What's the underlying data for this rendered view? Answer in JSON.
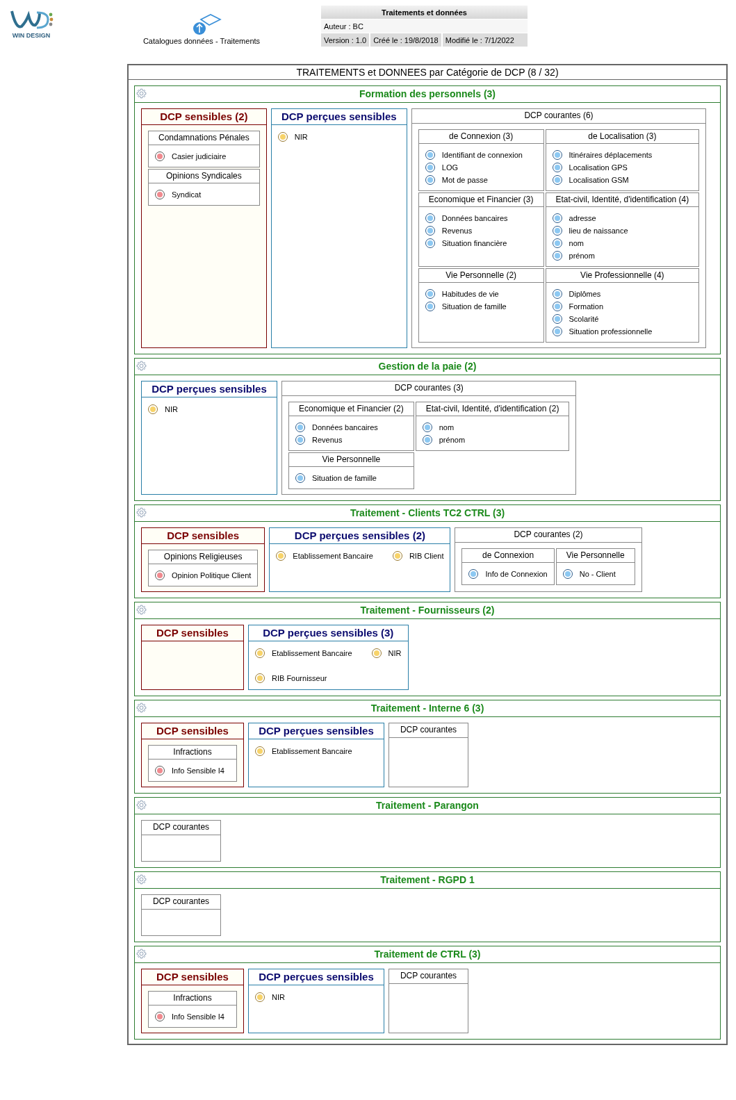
{
  "logo": {
    "wordmark": "WIN DESIGN"
  },
  "catalog": {
    "label": "Catalogues données - Traitements"
  },
  "info": {
    "title": "Traitements et données",
    "author": "Auteur : BC",
    "version": "Version : 1.0",
    "created": "Créé le : 19/8/2018",
    "modified": "Modifié le : 7/1/2022"
  },
  "diagram": {
    "title": "TRAITEMENTS et DONNEES par Catégorie de DCP (8 / 32)",
    "sections": [
      {
        "title": "Formation des personnels (3)",
        "panels": [
          {
            "kind": "sensitive",
            "title": "DCP sensibles (2)",
            "groups": [
              {
                "title": "Condamnations Pénales",
                "items": [
                  "Casier judiciaire"
                ]
              },
              {
                "title": "Opinions Syndicales",
                "items": [
                  "Syndicat"
                ]
              }
            ]
          },
          {
            "kind": "perceived",
            "title": "DCP perçues sensibles",
            "items": [
              "NIR"
            ]
          },
          {
            "kind": "common",
            "title": "DCP courantes (6)",
            "groups": [
              {
                "title": "de Connexion (3)",
                "items": [
                  "Identifiant de connexion",
                  "LOG",
                  "Mot de passe"
                ]
              },
              {
                "title": "de Localisation (3)",
                "items": [
                  "Itinéraires déplacements",
                  "Localisation GPS",
                  "Localisation GSM"
                ]
              },
              {
                "title": "Economique et Financier (3)",
                "items": [
                  "Données bancaires",
                  "Revenus",
                  "Situation financière"
                ]
              },
              {
                "title": "Etat-civil, Identité, d'identification (4)",
                "items": [
                  "adresse",
                  "lieu de naissance",
                  "nom",
                  "prénom"
                ]
              },
              {
                "title": "Vie Personnelle (2)",
                "items": [
                  "Habitudes de vie",
                  "Situation de famille"
                ]
              },
              {
                "title": "Vie Professionnelle (4)",
                "items": [
                  "Diplômes",
                  "Formation",
                  "Scolarité",
                  "Situation professionnelle"
                ]
              }
            ]
          }
        ]
      },
      {
        "title": "Gestion de la paie (2)",
        "panels": [
          {
            "kind": "perceived",
            "title": "DCP perçues sensibles",
            "items": [
              "NIR"
            ]
          },
          {
            "kind": "common",
            "title": "DCP courantes (3)",
            "groups": [
              {
                "title": "Economique et Financier (2)",
                "items": [
                  "Données bancaires",
                  "Revenus"
                ]
              },
              {
                "title": "Etat-civil, Identité, d'identification (2)",
                "items": [
                  "nom",
                  "prénom"
                ]
              },
              {
                "title": "Vie Personnelle",
                "items": [
                  "Situation de famille"
                ]
              }
            ]
          }
        ]
      },
      {
        "title": "Traitement - Clients TC2 CTRL (3)",
        "panels": [
          {
            "kind": "sensitive",
            "title": "DCP sensibles",
            "groups": [
              {
                "title": "Opinions Religieuses",
                "items": [
                  "Opinion Politique Client"
                ]
              }
            ]
          },
          {
            "kind": "perceived",
            "title": "DCP perçues sensibles (2)",
            "items": [
              "Etablissement Bancaire",
              "RIB Client"
            ]
          },
          {
            "kind": "common",
            "title": "DCP courantes (2)",
            "groups": [
              {
                "title": "de Connexion",
                "items": [
                  "Info de Connexion"
                ]
              },
              {
                "title": "Vie Personnelle",
                "items": [
                  "No - Client"
                ]
              }
            ]
          }
        ]
      },
      {
        "title": "Traitement - Fournisseurs (2)",
        "panels": [
          {
            "kind": "sensitive",
            "title": "DCP sensibles"
          },
          {
            "kind": "perceived",
            "title": "DCP perçues sensibles (3)",
            "items": [
              "Etablissement Bancaire",
              "NIR",
              "RIB Fournisseur"
            ]
          }
        ]
      },
      {
        "title": "Traitement - Interne 6 (3)",
        "panels": [
          {
            "kind": "sensitive",
            "title": "DCP sensibles",
            "groups": [
              {
                "title": "Infractions",
                "items": [
                  "Info Sensible I4"
                ]
              }
            ]
          },
          {
            "kind": "perceived",
            "title": "DCP perçues sensibles",
            "items": [
              "Etablissement Bancaire"
            ]
          },
          {
            "kind": "common",
            "title": "DCP courantes"
          }
        ]
      },
      {
        "title": "Traitement - Parangon",
        "panels": [
          {
            "kind": "common",
            "title": "DCP courantes"
          }
        ]
      },
      {
        "title": "Traitement - RGPD 1",
        "panels": [
          {
            "kind": "common",
            "title": "DCP courantes"
          }
        ]
      },
      {
        "title": "Traitement de CTRL (3)",
        "panels": [
          {
            "kind": "sensitive",
            "title": "DCP sensibles",
            "groups": [
              {
                "title": "Infractions",
                "items": [
                  "Info Sensible I4"
                ]
              }
            ]
          },
          {
            "kind": "perceived",
            "title": "DCP perçues sensibles",
            "items": [
              "NIR"
            ]
          },
          {
            "kind": "common",
            "title": "DCP courantes"
          }
        ]
      }
    ]
  }
}
